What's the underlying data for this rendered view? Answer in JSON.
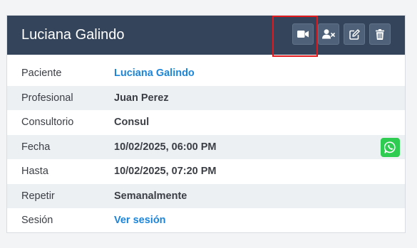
{
  "header": {
    "title": "Luciana Galindo",
    "actions": [
      {
        "name": "video-call-button",
        "icon": "video-camera-icon"
      },
      {
        "name": "remove-patient-button",
        "icon": "user-x-icon"
      },
      {
        "name": "edit-button",
        "icon": "edit-icon"
      },
      {
        "name": "delete-button",
        "icon": "trash-icon"
      }
    ]
  },
  "details": {
    "paciente": {
      "label": "Paciente",
      "value": "Luciana Galindo"
    },
    "profesional": {
      "label": "Profesional",
      "value": "Juan Perez"
    },
    "consultorio": {
      "label": "Consultorio",
      "value": "Consul"
    },
    "fecha": {
      "label": "Fecha",
      "value": "10/02/2025, 06:00 PM"
    },
    "hasta": {
      "label": "Hasta",
      "value": "10/02/2025, 07:20 PM"
    },
    "repetir": {
      "label": "Repetir",
      "value": "Semanalmente"
    },
    "sesion": {
      "label": "Sesión",
      "value": "Ver sesión"
    }
  },
  "colors": {
    "header_bg": "#34445a",
    "link": "#1c85d8",
    "whatsapp": "#2ecc51",
    "highlight": "#e0191d"
  }
}
